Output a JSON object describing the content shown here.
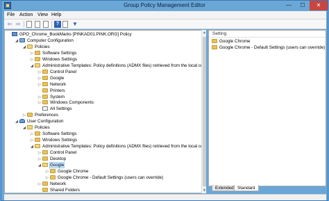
{
  "window": {
    "title": "Group Policy Management Editor",
    "controls": {
      "minimize": "—",
      "maximize": "☐",
      "close": "✕"
    }
  },
  "menu": [
    "File",
    "Action",
    "View",
    "Help"
  ],
  "toolbar": {
    "back": "⇦",
    "forward": "⇨",
    "help": "?",
    "filter": "▼"
  },
  "tree": [
    {
      "label": "GPO_Chrome_BookMarks [PINKAD01.PINK.ORG] Policy",
      "indent": 0,
      "toggle": "",
      "icon": "gpo"
    },
    {
      "label": "Computer Configuration",
      "indent": 1,
      "toggle": "◢",
      "icon": "pc"
    },
    {
      "label": "Policies",
      "indent": 2,
      "toggle": "◢",
      "icon": "folder-open"
    },
    {
      "label": "Software Settings",
      "indent": 3,
      "toggle": "▷",
      "icon": "folder"
    },
    {
      "label": "Windows Settings",
      "indent": 3,
      "toggle": "▷",
      "icon": "folder"
    },
    {
      "label": "Administrative Templates: Policy definitions (ADMX files) retrieved from the local computer.",
      "indent": 3,
      "toggle": "◢",
      "icon": "folder-open"
    },
    {
      "label": "Control Panel",
      "indent": 4,
      "toggle": "▷",
      "icon": "folder"
    },
    {
      "label": "Google",
      "indent": 4,
      "toggle": "▷",
      "icon": "folder"
    },
    {
      "label": "Network",
      "indent": 4,
      "toggle": "▷",
      "icon": "folder"
    },
    {
      "label": "Printers",
      "indent": 4,
      "toggle": "",
      "icon": "folder"
    },
    {
      "label": "System",
      "indent": 4,
      "toggle": "▷",
      "icon": "folder"
    },
    {
      "label": "Windows Components",
      "indent": 4,
      "toggle": "▷",
      "icon": "folder"
    },
    {
      "label": "All Settings",
      "indent": 4,
      "toggle": "",
      "icon": "doc"
    },
    {
      "label": "Preferences",
      "indent": 2,
      "toggle": "▷",
      "icon": "folder"
    },
    {
      "label": "User Configuration",
      "indent": 1,
      "toggle": "◢",
      "icon": "user"
    },
    {
      "label": "Policies",
      "indent": 2,
      "toggle": "◢",
      "icon": "folder-open"
    },
    {
      "label": "Software Settings",
      "indent": 3,
      "toggle": "▷",
      "icon": "folder"
    },
    {
      "label": "Windows Settings",
      "indent": 3,
      "toggle": "▷",
      "icon": "folder"
    },
    {
      "label": "Administrative Templates: Policy definitions (ADMX files) retrieved from the local computer.",
      "indent": 3,
      "toggle": "◢",
      "icon": "folder-open"
    },
    {
      "label": "Control Panel",
      "indent": 4,
      "toggle": "▷",
      "icon": "folder"
    },
    {
      "label": "Desktop",
      "indent": 4,
      "toggle": "▷",
      "icon": "folder"
    },
    {
      "label": "Google",
      "indent": 4,
      "toggle": "◢",
      "icon": "folder-open",
      "selected": true
    },
    {
      "label": "Google Chrome",
      "indent": 5,
      "toggle": "▷",
      "icon": "folder"
    },
    {
      "label": "Google Chrome - Default Settings (users can override)",
      "indent": 5,
      "toggle": "▷",
      "icon": "folder"
    },
    {
      "label": "Network",
      "indent": 4,
      "toggle": "▷",
      "icon": "folder"
    },
    {
      "label": "Shared Folders",
      "indent": 4,
      "toggle": "",
      "icon": "folder"
    }
  ],
  "right": {
    "column_header": "Setting",
    "items": [
      {
        "label": "Google Chrome",
        "icon": "folder"
      },
      {
        "label": "Google Chrome - Default Settings (users can override)",
        "icon": "folder"
      }
    ]
  },
  "tabs": [
    "Extended",
    "Standard"
  ],
  "active_tab": "Standard"
}
